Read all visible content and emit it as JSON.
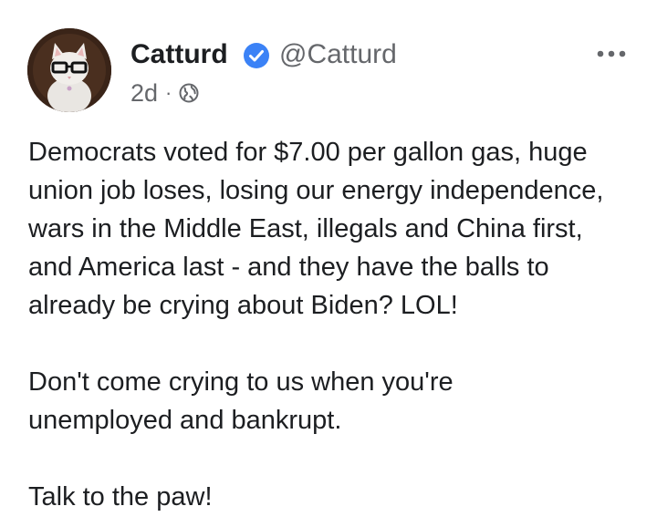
{
  "author": {
    "name": "Catturd",
    "handle": "@Catturd",
    "verified_color": "#3b82f6"
  },
  "meta": {
    "time": "2d",
    "separator": "·",
    "audience_icon": "globe-icon"
  },
  "more_icon": "more-options-icon",
  "post": {
    "paragraphs": [
      {
        "lines": [
          "Democrats voted for $7.00 per gallon gas, huge",
          "union job loses, losing our energy independence,",
          "wars in the Middle East, illegals and China first,",
          "and America last - and they have the balls to",
          "already be crying about Biden? LOL!"
        ]
      },
      {
        "lines": [
          "Don't come crying to us when you're",
          "unemployed and bankrupt."
        ]
      },
      {
        "lines": [
          "Talk to the paw!"
        ]
      }
    ]
  }
}
